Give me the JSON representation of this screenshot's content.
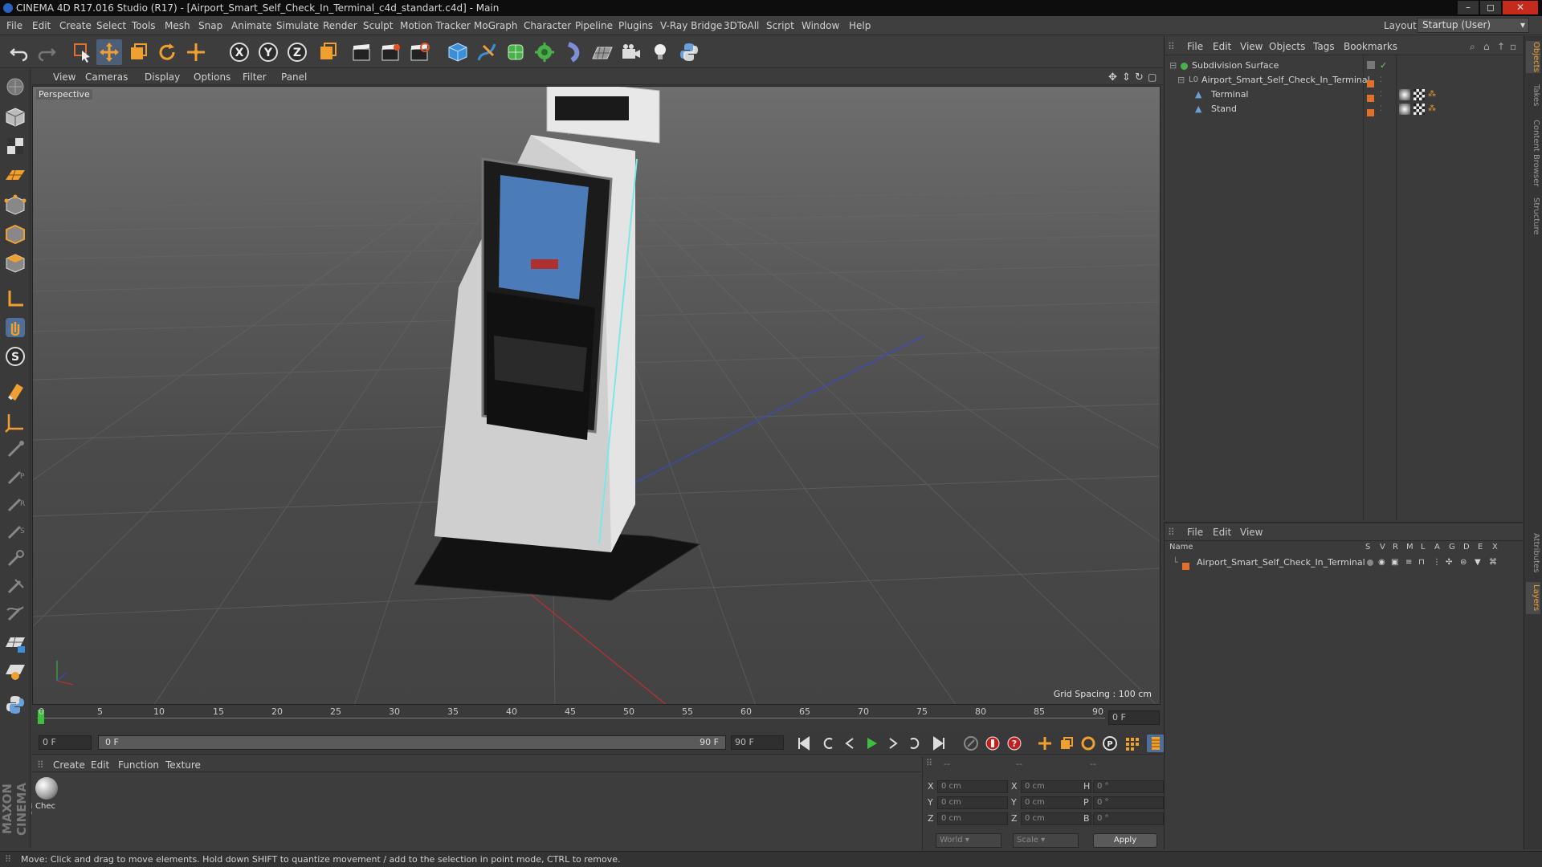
{
  "window": {
    "title": "CINEMA 4D R17.016 Studio (R17) - [Airport_Smart_Self_Check_In_Terminal_c4d_standart.c4d] - Main",
    "minimize": "–",
    "maximize": "◻",
    "close": "✕"
  },
  "menubar": {
    "items": [
      "File",
      "Edit",
      "Create",
      "Select",
      "Tools",
      "Mesh",
      "Snap",
      "Animate",
      "Simulate",
      "Render",
      "Sculpt",
      "Motion Tracker",
      "MoGraph",
      "Character",
      "Pipeline",
      "Plugins",
      "V-Ray Bridge",
      "3DToAll",
      "Script",
      "Window",
      "Help"
    ],
    "layout_label": "Layout:",
    "layout_value": "Startup (User)"
  },
  "viewport": {
    "menu": [
      "View",
      "Cameras",
      "Display",
      "Options",
      "Filter",
      "Panel"
    ],
    "label": "Perspective",
    "grid_spacing": "Grid Spacing : 100 cm"
  },
  "timeline": {
    "ticks": [
      "0",
      "5",
      "10",
      "15",
      "20",
      "25",
      "30",
      "35",
      "40",
      "45",
      "50",
      "55",
      "60",
      "65",
      "70",
      "75",
      "80",
      "85",
      "90"
    ],
    "current_frame": "0 F"
  },
  "transport": {
    "start_field": "0 F",
    "range_start": "0 F",
    "range_end": "90 F",
    "end_field": "90 F"
  },
  "materials": {
    "menu": [
      "Create",
      "Edit",
      "Function",
      "Texture"
    ],
    "items": [
      {
        "label": "Chec"
      }
    ]
  },
  "coordinates": {
    "header": [
      "--",
      "--",
      "--"
    ],
    "rows": [
      {
        "l1": "X",
        "v1": "0 cm",
        "l2": "X",
        "v2": "0 cm",
        "l3": "H",
        "v3": "0 °"
      },
      {
        "l1": "Y",
        "v1": "0 cm",
        "l2": "Y",
        "v2": "0 cm",
        "l3": "P",
        "v3": "0 °"
      },
      {
        "l1": "Z",
        "v1": "0 cm",
        "l2": "Z",
        "v2": "0 cm",
        "l3": "B",
        "v3": "0 °"
      }
    ],
    "mode": "World",
    "type": "Scale",
    "apply": "Apply"
  },
  "objects": {
    "menu": [
      "File",
      "Edit",
      "View",
      "Objects",
      "Tags",
      "Bookmarks"
    ],
    "items": [
      {
        "name": "Subdivision Surface"
      },
      {
        "name": "Airport_Smart_Self_Check_In_Terminal"
      },
      {
        "name": "Terminal"
      },
      {
        "name": "Stand"
      }
    ]
  },
  "layers": {
    "menu": [
      "File",
      "Edit",
      "View"
    ],
    "columns": [
      "Name",
      "S",
      "V",
      "R",
      "M",
      "L",
      "A",
      "G",
      "D",
      "E",
      "X"
    ],
    "rows": [
      {
        "name": "Airport_Smart_Self_Check_In_Terminal",
        "color": "#e0702a"
      }
    ]
  },
  "sidetabs": [
    "Objects",
    "Takes",
    "Content Browser",
    "Structure",
    "Attributes",
    "Layers"
  ],
  "branding": "MAXON CINEMA 4D",
  "status": "Move: Click and drag to move elements. Hold down SHIFT to quantize movement / add to the selection in point mode, CTRL to remove.",
  "colors": {
    "accent_orange": "#e0702a",
    "axis_blue": "#2a62c2",
    "selection_green": "#6ccf6c"
  }
}
